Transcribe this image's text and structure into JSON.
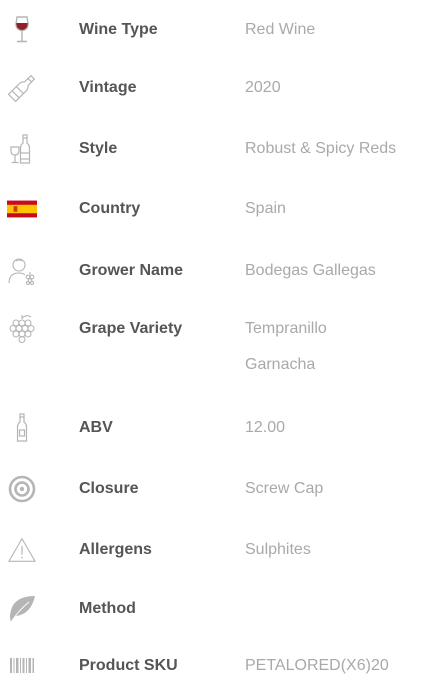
{
  "attributes": [
    {
      "icon": "wine-glass-icon",
      "label": "Wine Type",
      "value": "Red Wine"
    },
    {
      "icon": "wine-bottle-icon",
      "label": "Vintage",
      "value": "2020"
    },
    {
      "icon": "bottle-and-glass-icon",
      "label": "Style",
      "value": "Robust & Spicy Reds"
    },
    {
      "icon": "spain-flag-icon",
      "label": "Country",
      "value": "Spain"
    },
    {
      "icon": "grower-icon",
      "label": "Grower Name",
      "value": "Bodegas Gallegas"
    },
    {
      "icon": "grapes-icon",
      "label": "Grape Variety",
      "values": [
        "Tempranillo",
        "Garnacha"
      ]
    },
    {
      "icon": "bottle-outline-icon",
      "label": "ABV",
      "value": "12.00"
    },
    {
      "icon": "target-icon",
      "label": "Closure",
      "value": "Screw Cap"
    },
    {
      "icon": "warning-icon",
      "label": "Allergens",
      "value": "Sulphites"
    },
    {
      "icon": "leaf-icon",
      "label": "Method",
      "value": ""
    },
    {
      "icon": "barcode-icon",
      "label": "Product SKU",
      "value": "PETALORED(X6)20"
    }
  ],
  "colors": {
    "label": "#555555",
    "value": "#a9a9a9",
    "icon": "#b5b5b5",
    "wine_red": "#8e1f2b",
    "flag_red": "#c60b1e",
    "flag_yellow": "#ffc400"
  }
}
